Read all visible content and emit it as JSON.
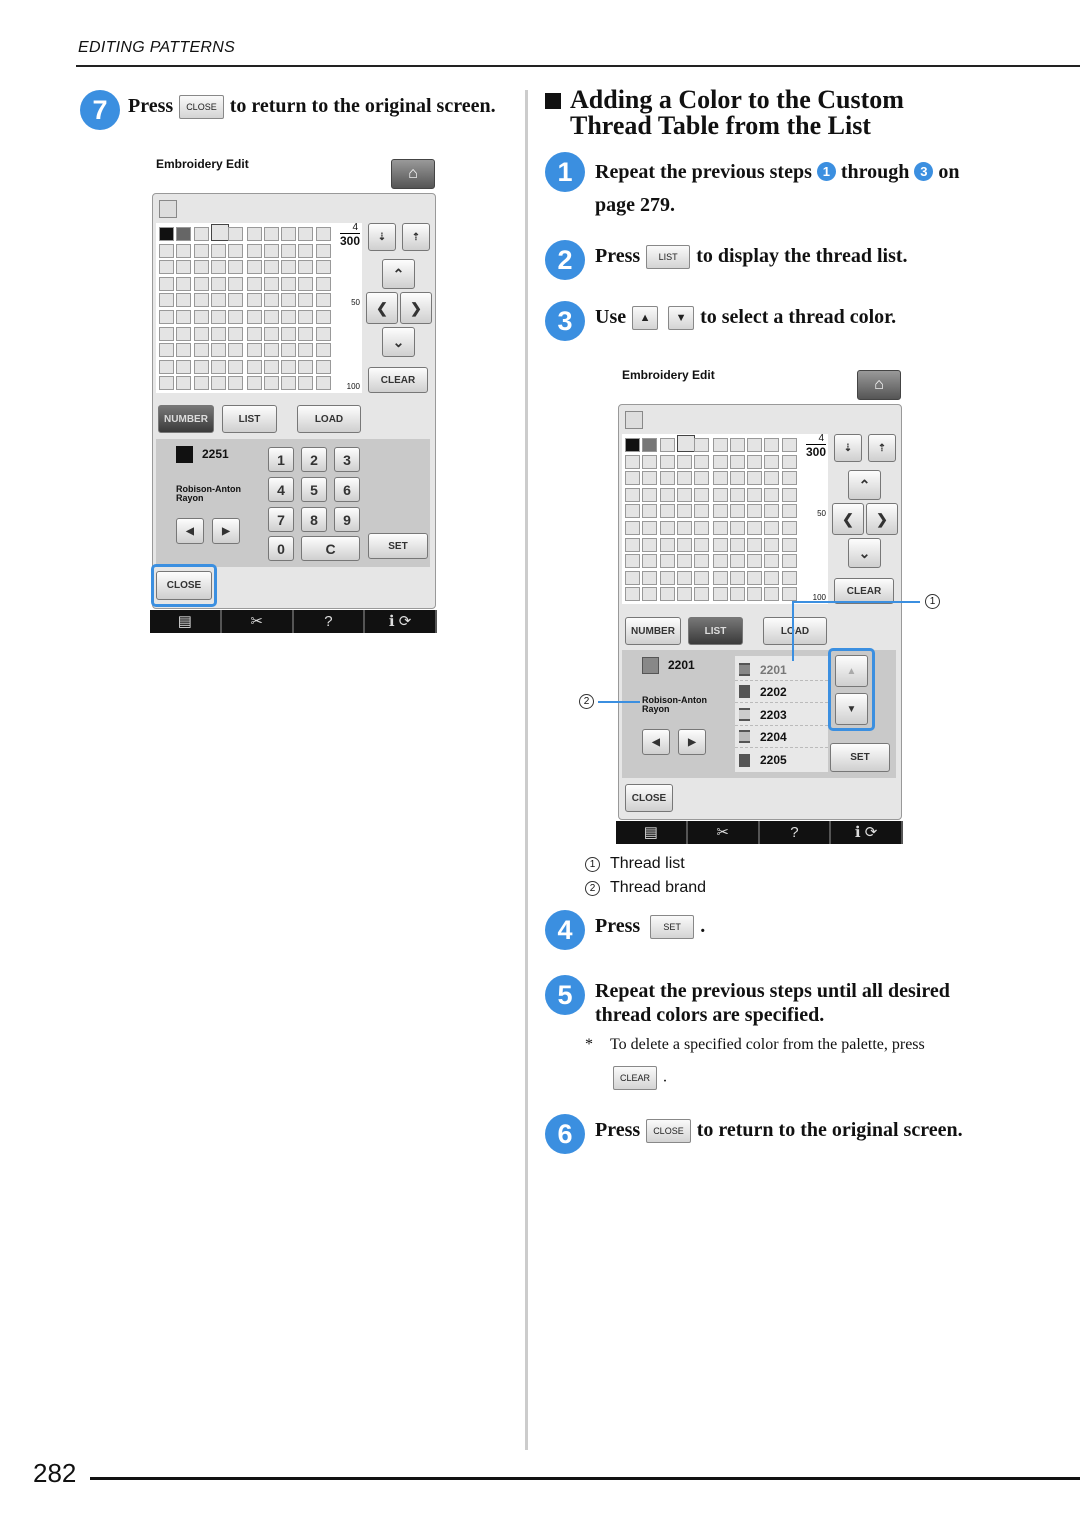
{
  "header": "EDITING PATTERNS",
  "page_number": "282",
  "accent": "#3b8fe0",
  "left": {
    "step7": {
      "num": "7",
      "press": "Press",
      "button": "CLOSE",
      "rest": "to return to the original screen."
    }
  },
  "screen1": {
    "title": "Embroidery Edit",
    "count_top": "4",
    "count_total": "300",
    "mark50": "50",
    "mark100": "100",
    "clear": "CLEAR",
    "number": "NUMBER",
    "list": "LIST",
    "load": "LOAD",
    "thread_number": "2251",
    "brand1": "Robison-Anton",
    "brand2": "Rayon",
    "keys": [
      "1",
      "2",
      "3",
      "4",
      "5",
      "6",
      "7",
      "8",
      "9",
      "0",
      "C"
    ],
    "set": "SET",
    "close": "CLOSE",
    "bar_help": "?"
  },
  "right": {
    "heading1": "Adding a Color to the Custom",
    "heading2": "Thread Table from the List",
    "step1": {
      "num": "1",
      "a": "Repeat the previous steps",
      "ref1": "1",
      "b": "through",
      "ref2": "3",
      "c": "on",
      "d": "page 279."
    },
    "step2": {
      "num": "2",
      "press": "Press",
      "button": "LIST",
      "rest": "to display the thread list."
    },
    "step3": {
      "num": "3",
      "use": "Use",
      "up": "▲",
      "down": "▼",
      "rest": "to select a thread color."
    },
    "legend": [
      {
        "mark": "1",
        "label": "Thread list"
      },
      {
        "mark": "2",
        "label": "Thread brand"
      }
    ],
    "step4": {
      "num": "4",
      "press": "Press",
      "button": "SET",
      "rest": "."
    },
    "step5": {
      "num": "5",
      "line1": "Repeat the previous steps until all desired",
      "line2": "thread colors are specified.",
      "note_star": "*",
      "note": "To delete a specified color from the palette, press",
      "note_button": "CLEAR",
      "note_end": "."
    },
    "step6": {
      "num": "6",
      "press": "Press",
      "button": "CLOSE",
      "rest": "to return to the original screen."
    }
  },
  "screen2": {
    "title": "Embroidery Edit",
    "count_top": "4",
    "count_total": "300",
    "mark50": "50",
    "mark100": "100",
    "clear": "CLEAR",
    "number": "NUMBER",
    "list": "LIST",
    "load": "LOAD",
    "thread_number": "2201",
    "brand1": "Robison-Anton",
    "brand2": "Rayon",
    "thread_list": [
      "2201",
      "2202",
      "2203",
      "2204",
      "2205"
    ],
    "set": "SET",
    "close": "CLOSE",
    "bar_help": "?",
    "callout1": "1",
    "callout2": "2"
  }
}
